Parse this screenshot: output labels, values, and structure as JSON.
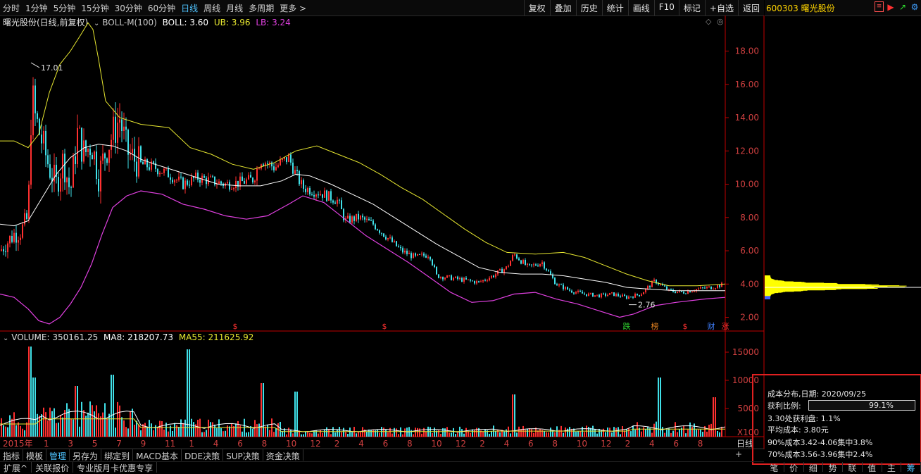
{
  "toolbar": {
    "periods": [
      "分时",
      "1分钟",
      "5分钟",
      "15分钟",
      "30分钟",
      "60分钟",
      "日线",
      "周线",
      "月线",
      "多周期",
      "更多 >"
    ],
    "active_period_index": 6,
    "buttons": [
      "复权",
      "叠加",
      "历史",
      "统计",
      "画线",
      "F10",
      "标记",
      "+自选",
      "返回"
    ]
  },
  "stock": {
    "code_name": "600303 曙光股份"
  },
  "chart_info": {
    "title": "曙光股份(日线,前复权)",
    "indicator": "BOLL-M(100)",
    "boll": "BOLL: 3.60",
    "ub": "UB: 3.96",
    "lb": "LB: 3.24"
  },
  "volume_info": {
    "volume": "VOLUME: 350161.25",
    "ma8": "MA8: 218207.73",
    "ma55": "MA55: 211625.92"
  },
  "colors": {
    "up": "#ff3030",
    "down": "#40e0e8",
    "mid": "#ffffff",
    "ub": "#e8e830",
    "lb": "#e040e0",
    "axis": "#c00000",
    "cost_yellow": "#ffff00"
  },
  "chart_data": {
    "type": "line",
    "price_axis": {
      "ticks": [
        "18.00",
        "16.00",
        "14.00",
        "12.00",
        "10.00",
        "8.00",
        "6.00",
        "4.00",
        "2.00"
      ],
      "range": [
        1.6,
        19.8
      ]
    },
    "volume_axis": {
      "ticks": [
        "15000",
        "10000",
        "5000",
        "X100"
      ]
    },
    "x_labels": [
      "2015年",
      "1",
      "3",
      "5",
      "7",
      "9",
      "11",
      "1",
      "4",
      "6",
      "8",
      "10",
      "12",
      "2",
      "4",
      "6",
      "8",
      "10",
      "12",
      "2",
      "4",
      "6",
      "8",
      "10",
      "12",
      "2",
      "4",
      "6",
      "8"
    ],
    "end_label": "日线",
    "annotations": {
      "high": "17.01",
      "low": "2.76"
    },
    "event_markers": [
      "跌",
      "榜",
      "财",
      "涨"
    ],
    "price_series": {
      "mid": [
        [
          0,
          7.6
        ],
        [
          20,
          7.5
        ],
        [
          40,
          7.8
        ],
        [
          60,
          9.2
        ],
        [
          80,
          10.6
        ],
        [
          100,
          11.6
        ],
        [
          120,
          12.2
        ],
        [
          140,
          12.4
        ],
        [
          160,
          12.3
        ],
        [
          180,
          12.0
        ],
        [
          200,
          11.5
        ],
        [
          220,
          11.2
        ],
        [
          250,
          10.8
        ],
        [
          280,
          10.4
        ],
        [
          310,
          10.0
        ],
        [
          340,
          9.9
        ],
        [
          370,
          9.9
        ],
        [
          400,
          10.2
        ],
        [
          420,
          10.6
        ],
        [
          440,
          10.5
        ],
        [
          470,
          10.0
        ],
        [
          500,
          9.4
        ],
        [
          530,
          8.8
        ],
        [
          560,
          8.0
        ],
        [
          590,
          7.2
        ],
        [
          620,
          6.4
        ],
        [
          650,
          5.7
        ],
        [
          680,
          5.0
        ],
        [
          710,
          4.7
        ],
        [
          740,
          4.6
        ],
        [
          770,
          4.6
        ],
        [
          800,
          4.5
        ],
        [
          830,
          4.3
        ],
        [
          860,
          4.1
        ],
        [
          890,
          3.8
        ],
        [
          920,
          3.7
        ],
        [
          960,
          3.6
        ],
        [
          1000,
          3.6
        ],
        [
          1030,
          3.6
        ]
      ],
      "ub": [
        [
          0,
          12.6
        ],
        [
          20,
          12.6
        ],
        [
          40,
          12.2
        ],
        [
          55,
          13.0
        ],
        [
          70,
          15.5
        ],
        [
          85,
          17.2
        ],
        [
          100,
          18.0
        ],
        [
          115,
          19.0
        ],
        [
          125,
          19.7
        ],
        [
          132,
          19.3
        ],
        [
          140,
          17.5
        ],
        [
          150,
          15.0
        ],
        [
          170,
          14.0
        ],
        [
          200,
          13.6
        ],
        [
          240,
          13.4
        ],
        [
          270,
          12.2
        ],
        [
          300,
          11.8
        ],
        [
          330,
          11.2
        ],
        [
          360,
          10.9
        ],
        [
          390,
          11.3
        ],
        [
          420,
          12.0
        ],
        [
          450,
          12.3
        ],
        [
          480,
          11.8
        ],
        [
          510,
          11.3
        ],
        [
          540,
          10.6
        ],
        [
          570,
          9.8
        ],
        [
          600,
          9.1
        ],
        [
          630,
          8.2
        ],
        [
          660,
          7.3
        ],
        [
          690,
          6.5
        ],
        [
          720,
          5.9
        ],
        [
          760,
          5.8
        ],
        [
          800,
          5.9
        ],
        [
          830,
          5.6
        ],
        [
          860,
          5.1
        ],
        [
          890,
          4.6
        ],
        [
          920,
          4.2
        ],
        [
          950,
          3.9
        ],
        [
          990,
          3.9
        ],
        [
          1030,
          4.0
        ]
      ],
      "lb": [
        [
          0,
          3.4
        ],
        [
          20,
          3.2
        ],
        [
          40,
          2.5
        ],
        [
          55,
          1.8
        ],
        [
          70,
          1.6
        ],
        [
          85,
          2.0
        ],
        [
          100,
          2.8
        ],
        [
          115,
          3.8
        ],
        [
          130,
          5.2
        ],
        [
          145,
          7.0
        ],
        [
          160,
          8.6
        ],
        [
          180,
          9.3
        ],
        [
          200,
          9.6
        ],
        [
          230,
          9.4
        ],
        [
          260,
          8.8
        ],
        [
          290,
          8.5
        ],
        [
          320,
          8.1
        ],
        [
          350,
          7.9
        ],
        [
          380,
          8.1
        ],
        [
          410,
          8.8
        ],
        [
          430,
          9.3
        ],
        [
          460,
          8.9
        ],
        [
          490,
          7.9
        ],
        [
          520,
          6.9
        ],
        [
          550,
          6.1
        ],
        [
          580,
          5.3
        ],
        [
          610,
          4.4
        ],
        [
          640,
          3.5
        ],
        [
          670,
          2.9
        ],
        [
          700,
          3.0
        ],
        [
          730,
          3.4
        ],
        [
          760,
          3.5
        ],
        [
          790,
          3.1
        ],
        [
          820,
          2.8
        ],
        [
          850,
          2.4
        ],
        [
          880,
          2.0
        ],
        [
          900,
          2.2
        ],
        [
          930,
          2.7
        ],
        [
          960,
          2.9
        ],
        [
          1000,
          3.1
        ],
        [
          1030,
          3.2
        ]
      ],
      "close": [
        [
          0,
          6.0
        ],
        [
          10,
          6.5
        ],
        [
          20,
          7.0
        ],
        [
          30,
          7.2
        ],
        [
          40,
          8.0
        ],
        [
          45,
          15.5
        ],
        [
          50,
          14.0
        ],
        [
          60,
          12.5
        ],
        [
          70,
          11.0
        ],
        [
          80,
          10.0
        ],
        [
          90,
          11.5
        ],
        [
          100,
          9.5
        ],
        [
          110,
          13.0
        ],
        [
          120,
          11.8
        ],
        [
          130,
          12.5
        ],
        [
          140,
          10.5
        ],
        [
          150,
          12.0
        ],
        [
          160,
          13.0
        ],
        [
          170,
          14.0
        ],
        [
          180,
          12.0
        ],
        [
          190,
          11.5
        ],
        [
          200,
          11.2
        ],
        [
          220,
          11.0
        ],
        [
          240,
          10.6
        ],
        [
          260,
          10.0
        ],
        [
          280,
          10.4
        ],
        [
          300,
          10.2
        ],
        [
          320,
          10.0
        ],
        [
          340,
          10.1
        ],
        [
          360,
          10.3
        ],
        [
          370,
          11.5
        ],
        [
          390,
          11.0
        ],
        [
          410,
          11.6
        ],
        [
          420,
          10.6
        ],
        [
          430,
          9.8
        ],
        [
          460,
          9.4
        ],
        [
          480,
          9.0
        ],
        [
          490,
          7.8
        ],
        [
          510,
          8.0
        ],
        [
          530,
          7.6
        ],
        [
          550,
          6.8
        ],
        [
          570,
          6.0
        ],
        [
          590,
          5.6
        ],
        [
          610,
          5.8
        ],
        [
          620,
          4.5
        ],
        [
          650,
          4.3
        ],
        [
          680,
          4.1
        ],
        [
          700,
          4.5
        ],
        [
          720,
          5.0
        ],
        [
          730,
          5.8
        ],
        [
          750,
          5.0
        ],
        [
          770,
          5.3
        ],
        [
          790,
          4.0
        ],
        [
          810,
          3.6
        ],
        [
          830,
          3.4
        ],
        [
          850,
          3.3
        ],
        [
          870,
          3.4
        ],
        [
          890,
          3.2
        ],
        [
          910,
          3.4
        ],
        [
          930,
          4.2
        ],
        [
          950,
          3.6
        ],
        [
          970,
          3.5
        ],
        [
          990,
          3.7
        ],
        [
          1010,
          3.8
        ],
        [
          1030,
          4.0
        ]
      ]
    }
  },
  "cost_panel": {
    "title": "成本分布,日期: 2020/09/25",
    "profit_label": "获利比例:",
    "profit_value": "99.1%",
    "profit_ratio": 0.991,
    "line3": "3.30处获利盘: 1.1%",
    "line4": "平均成本: 3.80元",
    "line5": "90%成本3.42-4.06集中3.8%",
    "line6": "70%成本3.56-3.96集中2.4%"
  },
  "bottom_tabs": [
    "指标",
    "模板",
    "管理",
    "另存为",
    "绑定到",
    "MACD基本",
    "DDE决策",
    "SUP决策",
    "资金决策"
  ],
  "active_bottom_index": 2,
  "promo_bar": [
    "扩展^",
    "关联报价",
    "专业版月卡优惠专享"
  ],
  "right_bottom_tabs": [
    "笔",
    "价",
    "细",
    "势",
    "联",
    "值",
    "主",
    "筹"
  ],
  "active_right_bottom_index": 7,
  "plus_sign": "+"
}
